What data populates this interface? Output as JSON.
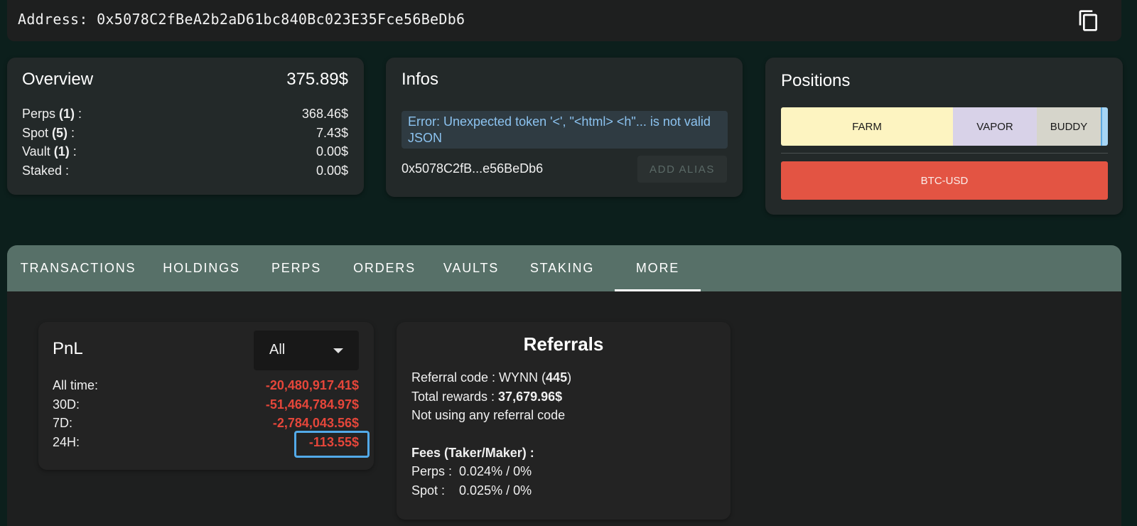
{
  "address": {
    "label": "Address:",
    "value": "0x5078C2fBeA2b2aD61bc840Bc023E35Fce56BeDb6"
  },
  "overview": {
    "title": "Overview",
    "total": "375.89$",
    "rows": [
      {
        "name": "Perps",
        "count": "(1)",
        "suffix": " :",
        "value": "368.46$"
      },
      {
        "name": "Spot",
        "count": "(5)",
        "suffix": " :",
        "value": "7.43$"
      },
      {
        "name": "Vault",
        "count": "(1)",
        "suffix": " :",
        "value": "0.00$"
      },
      {
        "name": "Staked",
        "count": "",
        "suffix": " :",
        "value": "0.00$"
      }
    ]
  },
  "infos": {
    "title": "Infos",
    "error": "Error: Unexpected token '<', \"<html> <h\"... is not valid JSON",
    "short_address": "0x5078C2fB...e56BeDb6",
    "add_alias_label": "ADD ALIAS"
  },
  "positions": {
    "title": "Positions",
    "segments": [
      "FARM",
      "VAPOR",
      "BUDDY"
    ],
    "btc": "BTC-USD"
  },
  "tabs": [
    "TRANSACTIONS",
    "HOLDINGS",
    "PERPS",
    "ORDERS",
    "VAULTS",
    "STAKING",
    "MORE"
  ],
  "active_tab": "MORE",
  "pnl": {
    "title": "PnL",
    "period_selected": "All",
    "rows": [
      {
        "label": "All time:",
        "value": "-20,480,917.41$"
      },
      {
        "label": "30D:",
        "value": "-51,464,784.97$"
      },
      {
        "label": "7D:",
        "value": "-2,784,043.56$"
      },
      {
        "label": "24H:",
        "value": "-113.55$"
      }
    ]
  },
  "referrals": {
    "title": "Referrals",
    "code_label": "Referral code : WYNN (",
    "code_count": "445",
    "code_close": ")",
    "rewards_label": "Total rewards : ",
    "rewards_value": "37,679.96$",
    "not_using": "Not using any referral code",
    "fees_title": "Fees (Taker/Maker) :",
    "perps_fee": "Perps :  0.024% / 0%",
    "spot_fee": "Spot :    0.025% / 0%"
  },
  "colors": {
    "negative": "#e5463a",
    "tab_bar": "#577068",
    "highlight": "#52a9e8"
  }
}
